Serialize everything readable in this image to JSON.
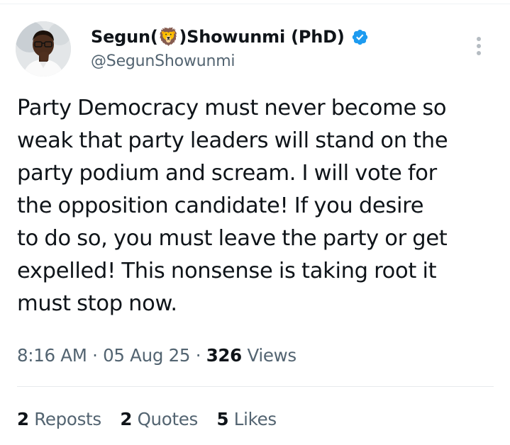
{
  "author": {
    "name_prefix": "Segun(",
    "name_emoji": "🦁",
    "name_suffix": ")Showunmi (PhD)",
    "handle": "@SegunShowunmi",
    "verified_icon": "verified-badge-icon",
    "verified_color": "#1d9bf0"
  },
  "tweet": {
    "text": "Party Democracy must never become so\nweak that party leaders will stand on the\nparty podium and scream. I will vote for\nthe opposition candidate! If you desire\nto do so, you must leave the party or get\nexpelled! This nonsense is taking root it\nmust stop now."
  },
  "meta": {
    "time": "8:16 AM",
    "separator": "·",
    "date": "05 Aug 25",
    "views_count": "326",
    "views_label": "Views"
  },
  "stats": {
    "reposts_count": "2",
    "reposts_label": "Reposts",
    "quotes_count": "2",
    "quotes_label": "Quotes",
    "likes_count": "5",
    "likes_label": "Likes"
  },
  "colors": {
    "text_primary": "#0f1419",
    "text_secondary": "#536471",
    "accent": "#1d9bf0"
  }
}
